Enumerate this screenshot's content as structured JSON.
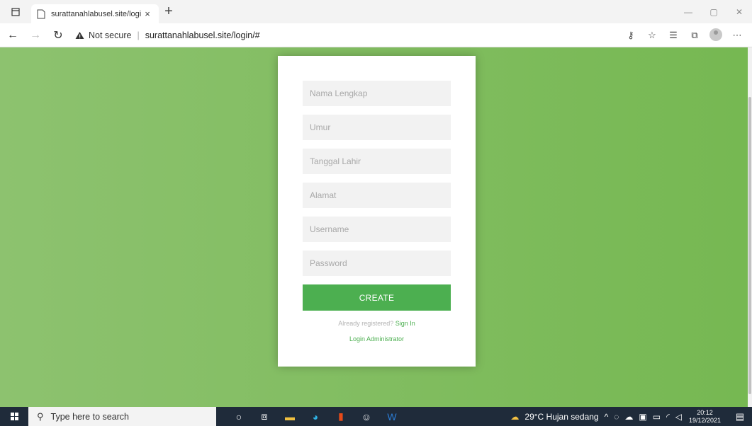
{
  "browser": {
    "tab_title": "surattanahlabusel.site/login/#",
    "tab_close": "×",
    "new_tab": "+",
    "address_warning": "Not secure",
    "address_url": "surattanahlabusel.site/login/#"
  },
  "form": {
    "fields": [
      {
        "placeholder": "Nama Lengkap"
      },
      {
        "placeholder": "Umur"
      },
      {
        "placeholder": "Tanggal Lahir"
      },
      {
        "placeholder": "Alamat"
      },
      {
        "placeholder": "Username"
      },
      {
        "placeholder": "Password"
      }
    ],
    "create_label": "CREATE",
    "already_text": "Already registered?",
    "sign_in_label": "Sign In",
    "admin_login_label": "Login Administrator"
  },
  "taskbar": {
    "search_placeholder": "Type here to search",
    "weather": "29°C  Hujan sedang",
    "time": "20:12",
    "date": "19/12/2021"
  },
  "colors": {
    "page_bg": "#76b852",
    "button": "#4caf50",
    "taskbar": "#1f2b3a"
  }
}
